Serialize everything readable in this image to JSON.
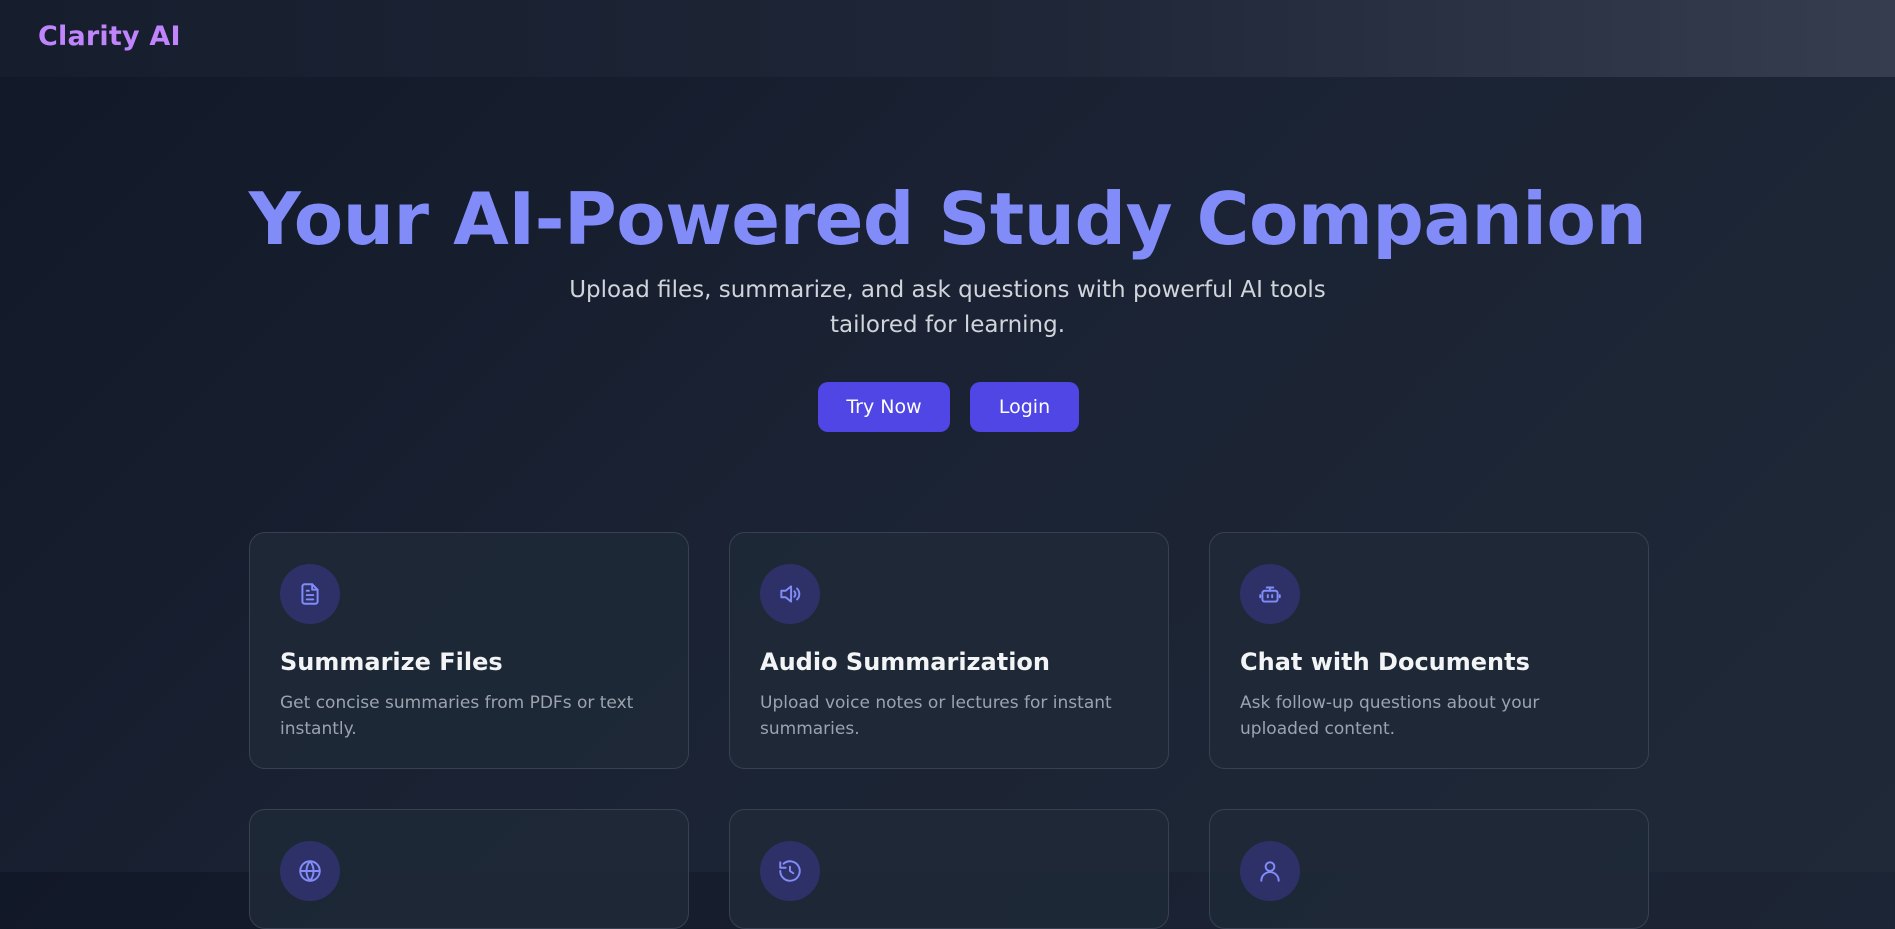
{
  "nav": {
    "brand": "Clarity AI"
  },
  "hero": {
    "title": "Your AI-Powered Study Companion",
    "subtitle": "Upload files, summarize, and ask questions with powerful AI tools tailored for learning.",
    "try_label": "Try Now",
    "login_label": "Login"
  },
  "colors": {
    "accent": "#818cf8",
    "button": "#4f46e5",
    "brand": "#c084fc",
    "background": "#111827"
  },
  "features": [
    {
      "icon": "file-text-icon",
      "title": "Summarize Files",
      "description": "Get concise summaries from PDFs or text instantly."
    },
    {
      "icon": "speaker-icon",
      "title": "Audio Summarization",
      "description": "Upload voice notes or lectures for instant summaries."
    },
    {
      "icon": "bot-icon",
      "title": "Chat with Documents",
      "description": "Ask follow-up questions about your uploaded content."
    },
    {
      "icon": "globe-icon"
    },
    {
      "icon": "history-icon"
    },
    {
      "icon": "user-icon"
    }
  ]
}
